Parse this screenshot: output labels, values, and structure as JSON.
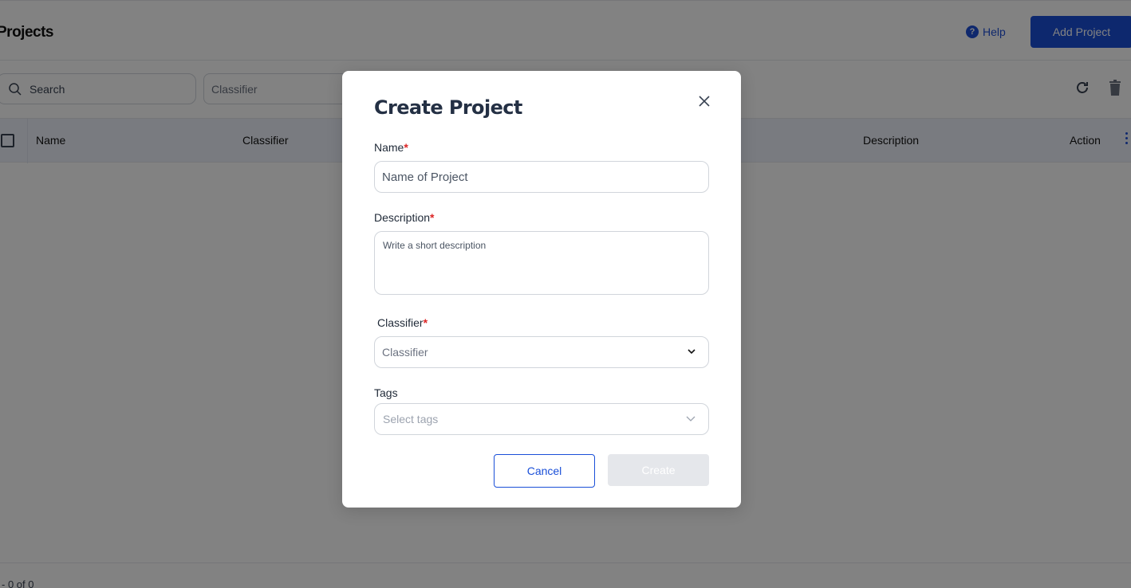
{
  "header": {
    "title": "Projects",
    "help_label": "Help",
    "help_icon_glyph": "?",
    "add_button_label": "Add Project"
  },
  "toolbar": {
    "search_placeholder": "Search",
    "classifier_filter_placeholder": "Classifier"
  },
  "table": {
    "columns": [
      "Name",
      "Classifier",
      "Description",
      "Action"
    ]
  },
  "footer": {
    "pagination": "- 0 of 0"
  },
  "modal": {
    "title": "Create Project",
    "name_label": "Name",
    "name_placeholder": "Name of Project",
    "description_label": "Description",
    "description_placeholder": "Write a short description",
    "classifier_label": "Classifier",
    "classifier_placeholder": "Classifier",
    "tags_label": "Tags",
    "tags_placeholder": "Select tags",
    "required_mark": "*",
    "cancel_label": "Cancel",
    "create_label": "Create"
  },
  "colors": {
    "primary": "#1a4fd8",
    "required": "#dc2626",
    "overlay": "rgba(0,0,0,0.49)"
  }
}
